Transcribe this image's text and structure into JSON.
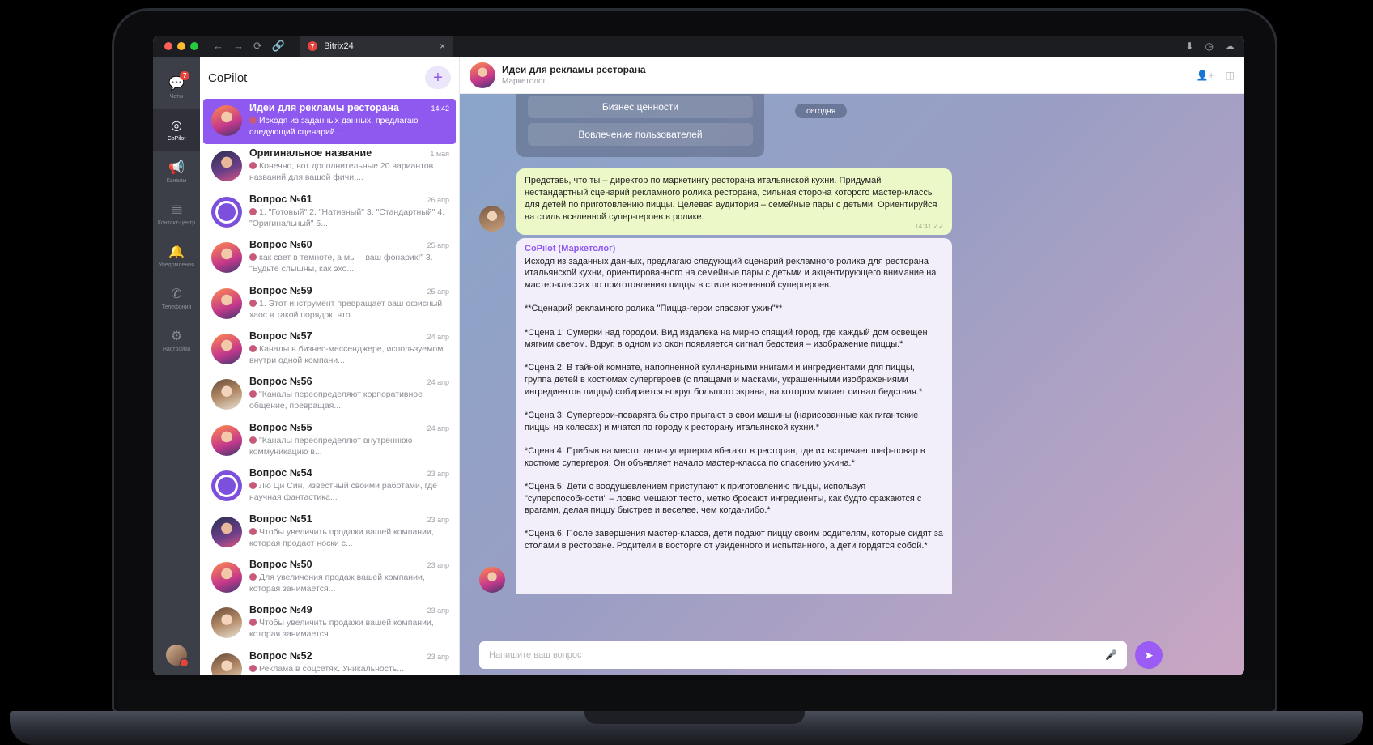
{
  "browser": {
    "tab_title": "Bitrix24",
    "tab_badge": "7",
    "nav": [
      "←",
      "→",
      "⟳",
      "🔗"
    ],
    "close": "×"
  },
  "rail": {
    "items": [
      {
        "label": "Чаты",
        "icon": "chat-icon",
        "badge": "7"
      },
      {
        "label": "CoPilot",
        "icon": "copilot-icon",
        "active": true
      },
      {
        "label": "Каналы",
        "icon": "megaphone-icon"
      },
      {
        "label": "Контакт-центр",
        "icon": "contact-center-icon"
      },
      {
        "label": "Уведомления",
        "icon": "bell-icon"
      },
      {
        "label": "Телефония",
        "icon": "phone-icon"
      },
      {
        "label": "Настройки",
        "icon": "gear-icon"
      }
    ]
  },
  "list": {
    "title": "CoPilot",
    "add_label": "+",
    "items": [
      {
        "title": "Идеи для рекламы ресторана",
        "time": "14:42",
        "preview": "Исходя из заданных данных, предлагаю следующий сценарий...",
        "avatar": "man",
        "active": true
      },
      {
        "title": "Оригинальное название",
        "time": "1 мая",
        "preview": "Конечно, вот дополнительные 20 вариантов названий для вашей фичи:...",
        "avatar": "dark"
      },
      {
        "title": "Вопрос №61",
        "time": "26 апр",
        "preview": "1. \"Готовый\" 2. \"Нативный\" 3. \"Стандартный\" 4. \"Оригинальный\" 5....",
        "avatar": "copilot"
      },
      {
        "title": "Вопрос №60",
        "time": "25 апр",
        "preview": "как свет в темноте, а мы – ваш фонарик!\" 3. \"Будьте слышны, как эхо...",
        "avatar": "man"
      },
      {
        "title": "Вопрос №59",
        "time": "25 апр",
        "preview": "1. Этот инструмент превращает ваш офисный хаос в такой порядок, что...",
        "avatar": "man"
      },
      {
        "title": "Вопрос №57",
        "time": "24 апр",
        "preview": "Каналы в бизнес-мессенджере, используемом внутри одной компани...",
        "avatar": "man"
      },
      {
        "title": "Вопрос №56",
        "time": "24 апр",
        "preview": "\"Каналы переопределяют корпоративное общение, превращая...",
        "avatar": "woman"
      },
      {
        "title": "Вопрос №55",
        "time": "24 апр",
        "preview": "\"Каналы переопределяют внутреннюю коммуникацию в...",
        "avatar": "man"
      },
      {
        "title": "Вопрос №54",
        "time": "23 апр",
        "preview": "Лю Ци Син, известный своими работами, где научная фантастика...",
        "avatar": "copilot"
      },
      {
        "title": "Вопрос №51",
        "time": "23 апр",
        "preview": "Чтобы увеличить продажи вашей компании, которая продает носки с...",
        "avatar": "dark"
      },
      {
        "title": "Вопрос №50",
        "time": "23 апр",
        "preview": "Для увеличения продаж вашей компании, которая занимается...",
        "avatar": "man"
      },
      {
        "title": "Вопрос №49",
        "time": "23 апр",
        "preview": "Чтобы увеличить продажи вашей компании, которая занимается...",
        "avatar": "woman"
      },
      {
        "title": "Вопрос №52",
        "time": "23 апр",
        "preview": "Реклама в соцсетях. Уникальность...",
        "avatar": "woman"
      }
    ]
  },
  "chat": {
    "title": "Идеи для рекламы ресторана",
    "subtitle": "Маркетолог",
    "keyboard": [
      "Бизнес ценности",
      "Вовлечение пользователей"
    ],
    "date": "сегодня",
    "user_message": "Представь, что ты – директор по маркетингу ресторана итальянской кухни. Придумай нестандартный сценарий рекламного ролика ресторана, сильная сторона которого мастер-классы для детей по приготовлению пиццы. Целевая аудитория – семейные пары с детьми. Ориентируйся на стиль вселенной супер-героев в ролике.",
    "user_time": "14:41",
    "bot_author": "CoPilot (Маркетолог)",
    "bot_paragraphs": [
      "Исходя из заданных данных, предлагаю следующий сценарий рекламного ролика для ресторана итальянской кухни, ориентированного на семейные пары с детьми и акцентирующего внимание на мастер-классах по приготовлению пиццы в стиле вселенной супергероев.",
      "**Сценарий рекламного ролика \"Пицца-герои спасают ужин\"**",
      "*Сцена 1: Сумерки над городом. Вид издалека на мирно спящий город, где каждый дом освещен мягким светом. Вдруг, в одном из окон появляется сигнал бедствия – изображение пиццы.*",
      "*Сцена 2: В тайной комнате, наполненной кулинарными книгами и ингредиентами для пиццы, группа детей в костюмах супергероев (с плащами и масками, украшенными изображениями ингредиентов пиццы) собирается вокруг большого экрана, на котором мигает сигнал бедствия.*",
      "*Сцена 3: Супергерои-поварята быстро прыгают в свои машины (нарисованные как гигантские пиццы на колесах) и мчатся по городу к ресторану итальянской кухни.*",
      "*Сцена 4: Прибыв на место, дети-супергерои вбегают в ресторан, где их встречает шеф-повар в костюме супергероя. Он объявляет начало мастер-класса по спасению ужина.*",
      "*Сцена 5: Дети с воодушевлением приступают к приготовлению пиццы, используя \"суперспособности\" – ловко мешают тесто, метко бросают ингредиенты, как будто сражаются с врагами, делая пиццу быстрее и веселее, чем когда-либо.*",
      "*Сцена 6: После завершения мастер-класса, дети подают пиццу своим родителям, которые сидят за столами в ресторане. Родители в восторге от увиденного и испытанного, а дети гордятся собой.*"
    ],
    "composer_placeholder": "Напишите ваш вопрос"
  },
  "colors": {
    "accent": "#8f58ef",
    "rail": "#3c3e48",
    "user_bubble": "#edf8c8"
  }
}
